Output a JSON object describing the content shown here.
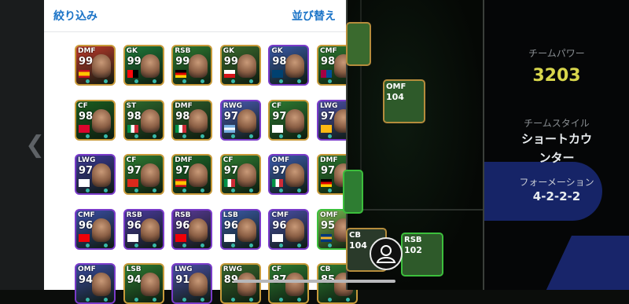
{
  "header": {
    "filter_label": "絞り込み",
    "sort_label": "並び替え"
  },
  "nav": {
    "back_icon": "chevron-left-icon"
  },
  "team_info": {
    "power_label": "チームパワー",
    "power_value": "3203",
    "style_label": "チームスタイル",
    "style_value_line1": "ショートカウ",
    "style_value_line2": "ンター",
    "formation_label": "フォーメーション",
    "formation_value": "4-2-2-2"
  },
  "pitch_players": [
    {
      "pos": "OMF",
      "ovr": "104"
    },
    {
      "pos": "CB",
      "ovr": "104"
    },
    {
      "pos": "RSB",
      "ovr": "102"
    }
  ],
  "colors": {
    "accent": "#1a73c7",
    "power": "#d8d64c",
    "gold_frame": "#c89a3a",
    "purple_frame": "#7a3bc9",
    "green_frame": "#3cbf3c"
  },
  "cards": [
    {
      "pos": "DMF",
      "ovr": "99",
      "frame": "#c89a3a",
      "bg": "#c0392b",
      "flag": "spain"
    },
    {
      "pos": "GK",
      "ovr": "99",
      "frame": "#c89a3a",
      "bg": "#1f7a3a",
      "flag": "milan"
    },
    {
      "pos": "RSB",
      "ovr": "99",
      "frame": "#c89a3a",
      "bg": "#2e7d32",
      "flag": "germany"
    },
    {
      "pos": "GK",
      "ovr": "99",
      "frame": "#c89a3a",
      "bg": "#3b6b2e",
      "flag": "czech"
    },
    {
      "pos": "GK",
      "ovr": "98",
      "frame": "#7a3bc9",
      "bg": "#3a5aa8",
      "flag": "psg"
    },
    {
      "pos": "CMF",
      "ovr": "98",
      "frame": "#c89a3a",
      "bg": "#2e7d32",
      "flag": "barca"
    },
    {
      "pos": "CF",
      "ovr": "98",
      "frame": "#c89a3a",
      "bg": "#1b5e20",
      "flag": "bayern"
    },
    {
      "pos": "ST",
      "ovr": "98",
      "frame": "#c89a3a",
      "bg": "#2e6a2e",
      "flag": "italy"
    },
    {
      "pos": "DMF",
      "ovr": "98",
      "frame": "#c89a3a",
      "bg": "#2d5d2a",
      "flag": "italy"
    },
    {
      "pos": "RWG",
      "ovr": "97",
      "frame": "#7a3bc9",
      "bg": "#4a5bb5",
      "flag": "argentina"
    },
    {
      "pos": "CF",
      "ovr": "97",
      "frame": "#c89a3a",
      "bg": "#2e7d32",
      "flag": "realmadrid"
    },
    {
      "pos": "LWG",
      "ovr": "97",
      "frame": "#7a3bc9",
      "bg": "#4c4fa8",
      "flag": "wolves"
    },
    {
      "pos": "LWG",
      "ovr": "97",
      "frame": "#7a3bc9",
      "bg": "#3e3a9a",
      "flag": "tottenham"
    },
    {
      "pos": "CF",
      "ovr": "97",
      "frame": "#c89a3a",
      "bg": "#2e7d32",
      "flag": "manutd"
    },
    {
      "pos": "DMF",
      "ovr": "97",
      "frame": "#c89a3a",
      "bg": "#1e6a2a",
      "flag": "spain"
    },
    {
      "pos": "CF",
      "ovr": "97",
      "frame": "#c89a3a",
      "bg": "#2e7d32",
      "flag": "italy"
    },
    {
      "pos": "OMF",
      "ovr": "97",
      "frame": "#7a3bc9",
      "bg": "#3c5cb0",
      "flag": "italy"
    },
    {
      "pos": "DMF",
      "ovr": "97",
      "frame": "#c89a3a",
      "bg": "#2e7d32",
      "flag": "germany"
    },
    {
      "pos": "CMF",
      "ovr": "96",
      "frame": "#7a3bc9",
      "bg": "#3b4fa8",
      "flag": "arsenal"
    },
    {
      "pos": "RSB",
      "ovr": "96",
      "frame": "#7a3bc9",
      "bg": "#4b3aa0",
      "flag": "tottenham"
    },
    {
      "pos": "RSB",
      "ovr": "96",
      "frame": "#7a3bc9",
      "bg": "#5a3a9a",
      "flag": "arsenal"
    },
    {
      "pos": "LSB",
      "ovr": "96",
      "frame": "#7a3bc9",
      "bg": "#3b5aa8",
      "flag": "tottenham"
    },
    {
      "pos": "CMF",
      "ovr": "96",
      "frame": "#7a3bc9",
      "bg": "#4a4fa8",
      "flag": "realmadrid"
    },
    {
      "pos": "OMF",
      "ovr": "95",
      "frame": "#3cbf3c",
      "bg": "#7ab852",
      "flag": "boca"
    },
    {
      "pos": "OMF",
      "ovr": "94",
      "frame": "#7a3bc9",
      "bg": "#3a4aa0",
      "flag": "none"
    },
    {
      "pos": "LSB",
      "ovr": "94",
      "frame": "#c89a3a",
      "bg": "#2e7d32",
      "flag": "none"
    },
    {
      "pos": "LWG",
      "ovr": "91",
      "frame": "#7a3bc9",
      "bg": "#4a4fa8",
      "flag": "none"
    },
    {
      "pos": "RWG",
      "ovr": "89",
      "frame": "#c89a3a",
      "bg": "#3a6a2e",
      "flag": "none"
    },
    {
      "pos": "CF",
      "ovr": "87",
      "frame": "#c89a3a",
      "bg": "#2e7d32",
      "flag": "none"
    },
    {
      "pos": "CB",
      "ovr": "85",
      "frame": "#c89a3a",
      "bg": "#2e7d32",
      "flag": "none"
    }
  ]
}
